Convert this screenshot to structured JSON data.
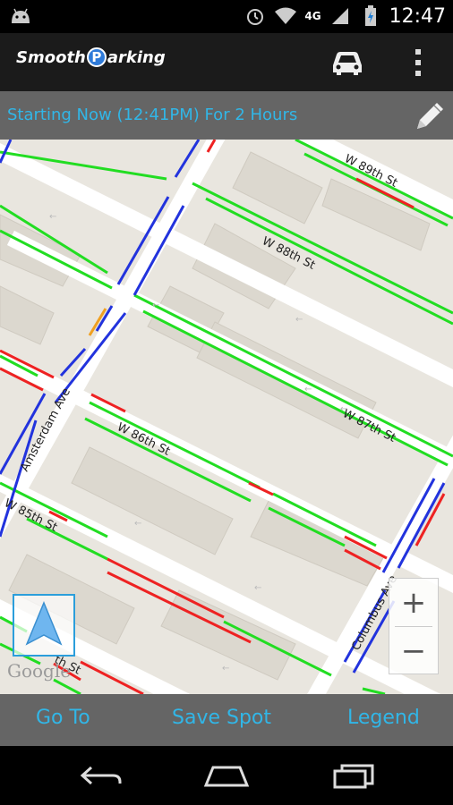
{
  "status_bar": {
    "time": "12:47",
    "network": "4G",
    "icons": [
      "android-icon",
      "alarm-icon",
      "wifi-icon",
      "signal-icon",
      "battery-icon"
    ]
  },
  "app_bar": {
    "logo_left": "Smooth",
    "logo_badge": "P",
    "logo_right": "arking",
    "actions": [
      "car-icon",
      "overflow-menu-icon"
    ]
  },
  "time_bar": {
    "text": "Starting Now (12:41PM) For 2 Hours",
    "edit_icon": "pencil-icon"
  },
  "map": {
    "streets": {
      "w89": "W 89th St",
      "w88": "W 88th St",
      "w87": "W 87th St",
      "w86": "W 86th St",
      "w85": "W 85th St",
      "w84_partial": "th St",
      "amsterdam": "Amsterdam Ave",
      "columbus": "Columbus Ave"
    },
    "attribution": "Google",
    "zoom_in": "+",
    "zoom_out": "−",
    "colors": {
      "allowed": "#22dd22",
      "no_parking": "#ee2222",
      "limited": "#2233dd",
      "warning": "#f0a020"
    }
  },
  "bottom_bar": {
    "goto": "Go To",
    "save_spot": "Save Spot",
    "legend": "Legend"
  },
  "nav_bar": {
    "buttons": [
      "back-icon",
      "home-icon",
      "recents-icon"
    ]
  }
}
